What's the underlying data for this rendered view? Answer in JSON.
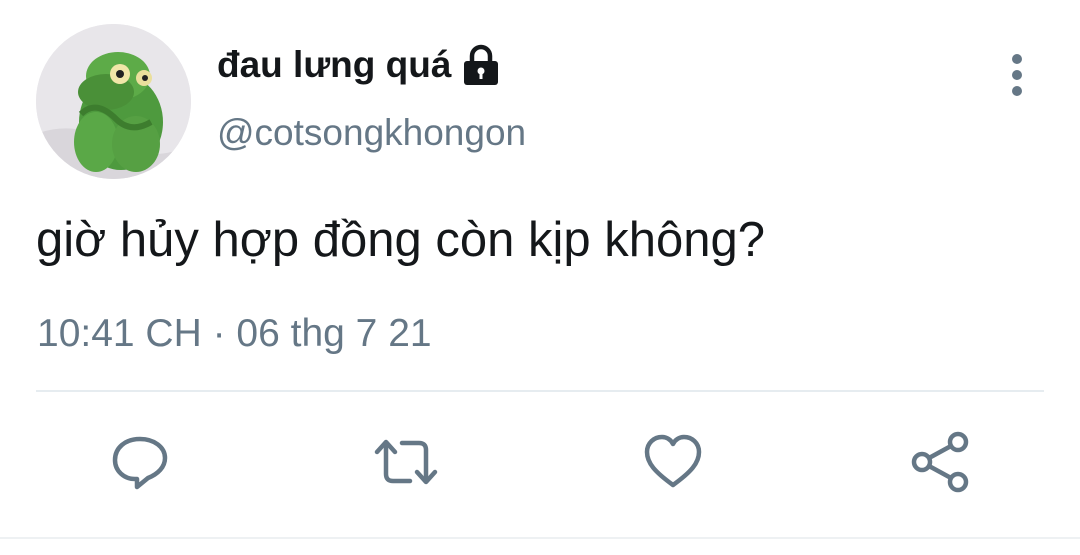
{
  "tweet": {
    "display_name": "đau lưng quá",
    "handle": "@cotsongkhongon",
    "text": "giờ hủy hợp đồng còn kịp không?",
    "timestamp": "10:41 CH · 06 thg 7 21",
    "protected": true
  },
  "icons": {
    "lock": "lock-icon",
    "more": "more-vertical-icon",
    "reply": "reply-icon",
    "retweet": "retweet-icon",
    "like": "heart-icon",
    "share": "share-icon"
  },
  "colors": {
    "text_primary": "#14171a",
    "text_secondary": "#657786",
    "icon": "#657786",
    "divider": "#e6ecf0"
  }
}
